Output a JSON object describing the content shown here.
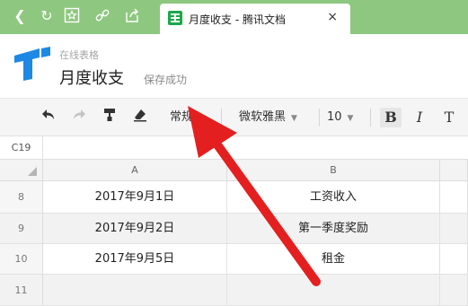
{
  "browser": {
    "nav_icons": [
      "back-icon",
      "refresh-icon",
      "favorite-icon",
      "link-icon",
      "share-icon"
    ],
    "tab": {
      "title": "月度收支 - 腾讯文档",
      "close_symbol": "×"
    }
  },
  "header": {
    "product_name": "在线表格",
    "doc_title": "月度收支",
    "save_status": "保存成功"
  },
  "toolbar": {
    "number_format": "常规",
    "font_family": "微软雅黑",
    "font_size": "10",
    "bold": "B",
    "italic": "I",
    "strike": "T"
  },
  "formula_bar": {
    "cell_ref": "C19"
  },
  "grid": {
    "columns": [
      "A",
      "B"
    ],
    "rows": [
      {
        "num": "8",
        "a": "2017年9月1日",
        "b": "工资收入"
      },
      {
        "num": "9",
        "a": "2017年9月2日",
        "b": "第一季度奖励"
      },
      {
        "num": "10",
        "a": "2017年9月5日",
        "b": "租金"
      },
      {
        "num": "11",
        "a": "",
        "b": ""
      }
    ]
  },
  "colors": {
    "browser_bar": "#8ec77f",
    "logo": "#1e88e5",
    "annotation_arrow": "#e41f1f"
  }
}
